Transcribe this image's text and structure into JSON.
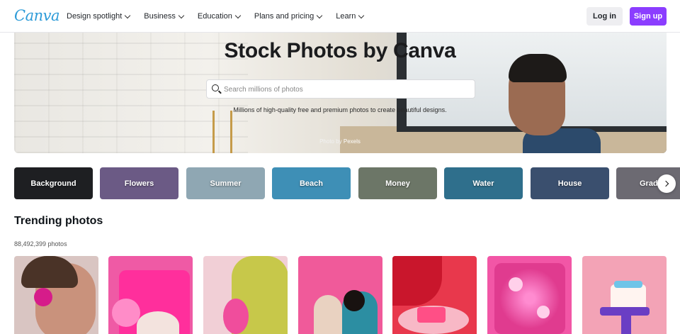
{
  "nav": {
    "logo": "Canva",
    "items": [
      {
        "label": "Design spotlight"
      },
      {
        "label": "Business"
      },
      {
        "label": "Education"
      },
      {
        "label": "Plans and pricing"
      },
      {
        "label": "Learn"
      }
    ],
    "login_label": "Log in",
    "signup_label": "Sign up"
  },
  "hero": {
    "title": "Stock Photos by Canva",
    "search_placeholder": "Search millions of photos",
    "subtitle": "Millions of high-quality free and premium photos to create beautiful designs.",
    "credit_prefix": "Photo by ",
    "credit_link": "Pexels"
  },
  "categories": [
    {
      "label": "Background",
      "color": "#1e1f22"
    },
    {
      "label": "Flowers",
      "color": "#6b5a85"
    },
    {
      "label": "Summer",
      "color": "#8fa7b3"
    },
    {
      "label": "Beach",
      "color": "#3e8fb6"
    },
    {
      "label": "Money",
      "color": "#6c7667"
    },
    {
      "label": "Water",
      "color": "#2f6f8c"
    },
    {
      "label": "House",
      "color": "#3a4f6e"
    },
    {
      "label": "Gradient",
      "color": "#6c6a72"
    }
  ],
  "trending": {
    "title": "Trending photos",
    "count": "88,492,399 photos"
  },
  "photos": [
    {
      "name": "woman-pink-flower",
      "color": "#d9c5c2"
    },
    {
      "name": "pink-blazer-cake",
      "color": "#ef5aa5"
    },
    {
      "name": "pineapple-yellow",
      "color": "#f1cfd6"
    },
    {
      "name": "two-women-pink",
      "color": "#f05a9a"
    },
    {
      "name": "red-sleeve-dessert",
      "color": "#e8384c"
    },
    {
      "name": "pink-confetti",
      "color": "#f256a6"
    },
    {
      "name": "birthday-cake-hand",
      "color": "#f3a3b6"
    }
  ]
}
